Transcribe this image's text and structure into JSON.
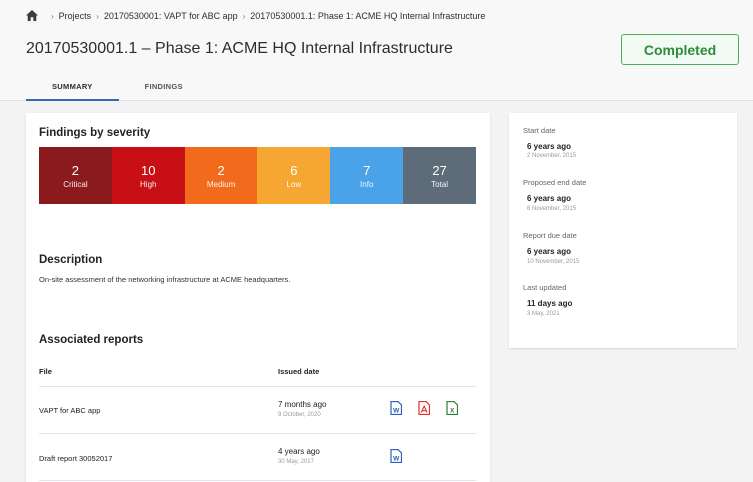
{
  "breadcrumb": {
    "items": [
      "Projects",
      "20170530001: VAPT for ABC app",
      "20170530001.1: Phase 1: ACME HQ Internal Infrastructure"
    ]
  },
  "page": {
    "title": "20170530001.1 – Phase 1: ACME HQ Internal Infrastructure",
    "status": "Completed"
  },
  "tabs": [
    {
      "label": "SUMMARY",
      "active": true
    },
    {
      "label": "FINDINGS",
      "active": false
    }
  ],
  "findings": {
    "title": "Findings by severity",
    "items": [
      {
        "count": "2",
        "label": "Critical",
        "color": "#8b1a1d"
      },
      {
        "count": "10",
        "label": "High",
        "color": "#c80f16"
      },
      {
        "count": "2",
        "label": "Medium",
        "color": "#f26a1b"
      },
      {
        "count": "6",
        "label": "Low",
        "color": "#f5a732"
      },
      {
        "count": "7",
        "label": "Info",
        "color": "#4aa3e8"
      },
      {
        "count": "27",
        "label": "Total",
        "color": "#5e6c79"
      }
    ]
  },
  "description": {
    "title": "Description",
    "text": "On-site assessment of the networking infrastructure at ACME headquarters."
  },
  "reports": {
    "title": "Associated reports",
    "col_file": "File",
    "col_date": "Issued date",
    "rows": [
      {
        "file": "VAPT for ABC app",
        "date": "7 months ago",
        "date_full": "9 October, 2020",
        "formats": [
          "word-icon",
          "pdf-icon",
          "excel-icon"
        ]
      },
      {
        "file": "Draft report 30052017",
        "date": "4 years ago",
        "date_full": "30 May, 2017",
        "formats": [
          "word-icon"
        ]
      }
    ]
  },
  "sidebar": {
    "start": {
      "label": "Start date",
      "value": "6 years ago",
      "sub": "2 November, 2015"
    },
    "end": {
      "label": "Proposed end date",
      "value": "6 years ago",
      "sub": "6 November, 2015"
    },
    "due": {
      "label": "Report due date",
      "value": "6 years ago",
      "sub": "10 November, 2015"
    },
    "updated": {
      "label": "Last updated",
      "value": "11 days ago",
      "sub": "3 May, 2021"
    }
  },
  "colors": {
    "accent": "#3a66b4",
    "status_green": "#4caf50",
    "word": "#2b5fb4",
    "pdf": "#e0302a",
    "excel": "#2e7d32"
  }
}
